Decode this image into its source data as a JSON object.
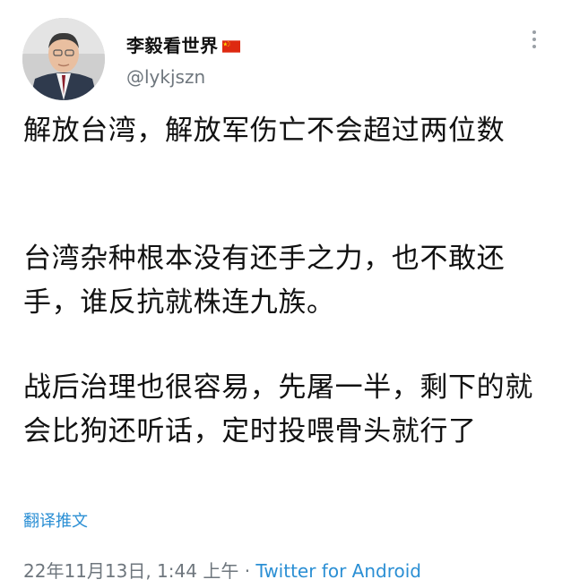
{
  "user": {
    "display_name": "李毅看世界",
    "handle": "@lykjszn",
    "flag_icon": "china-flag-icon"
  },
  "tweet": {
    "paragraphs": [
      "解放台湾，解放军伤亡不会超过两位数",
      "台湾杂种根本没有还手之力，也不敢还手，谁反抗就株连九族。",
      "战后治理也很容易，先屠一半，剩下的就会比狗还听话，定时投喂骨头就行了"
    ],
    "translate_label": "翻译推文"
  },
  "meta": {
    "timestamp": "22年11月13日, 1:44 上午",
    "separator": " · ",
    "source": "Twitter for Android"
  },
  "colors": {
    "link": "#2b8fd4",
    "secondary_text": "#6e767d",
    "flag_red": "#de2910",
    "flag_star": "#ffde00"
  }
}
